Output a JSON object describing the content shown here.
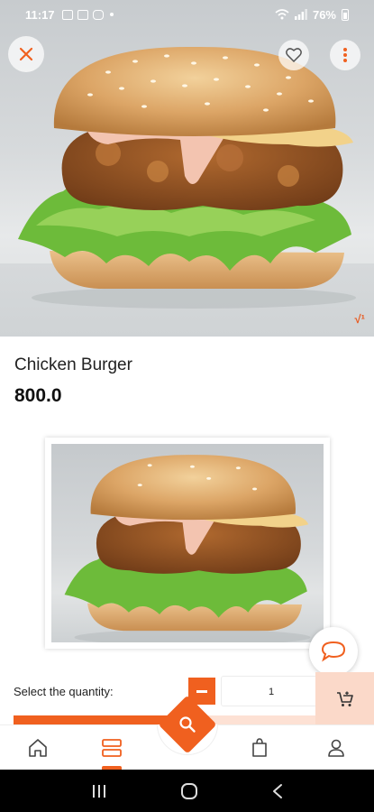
{
  "status_bar": {
    "time": "11:17",
    "battery": "76%",
    "left_icons": [
      "gallery-icon",
      "linkedin-icon",
      "instagram-icon",
      "dot-icon"
    ],
    "right_icons": [
      "wifi-icon",
      "signal-icon",
      "battery-icon"
    ]
  },
  "hero": {
    "close_icon": "close-icon",
    "favorite_icon": "heart-icon",
    "more_icon": "more-vertical-icon",
    "corner_badge": "√¹"
  },
  "product": {
    "name": "Chicken Burger",
    "price": "800.0"
  },
  "quantity": {
    "label": "Select the quantity:",
    "value": "1",
    "decrement_icon": "minus-icon",
    "add_to_cart_icon": "add-cart-icon",
    "progress_fraction": 0.53
  },
  "chat_icon": "chat-bubble-icon",
  "bottom_nav": {
    "items": [
      "home-icon",
      "menu-list-icon",
      "search-icon",
      "bag-icon",
      "profile-icon"
    ],
    "active": "menu-list-icon"
  },
  "system_nav": [
    "recents-icon",
    "home-circle-icon",
    "back-icon"
  ],
  "colors": {
    "accent": "#f0601f",
    "accent_light": "#fbd9c9",
    "text": "#222222"
  }
}
